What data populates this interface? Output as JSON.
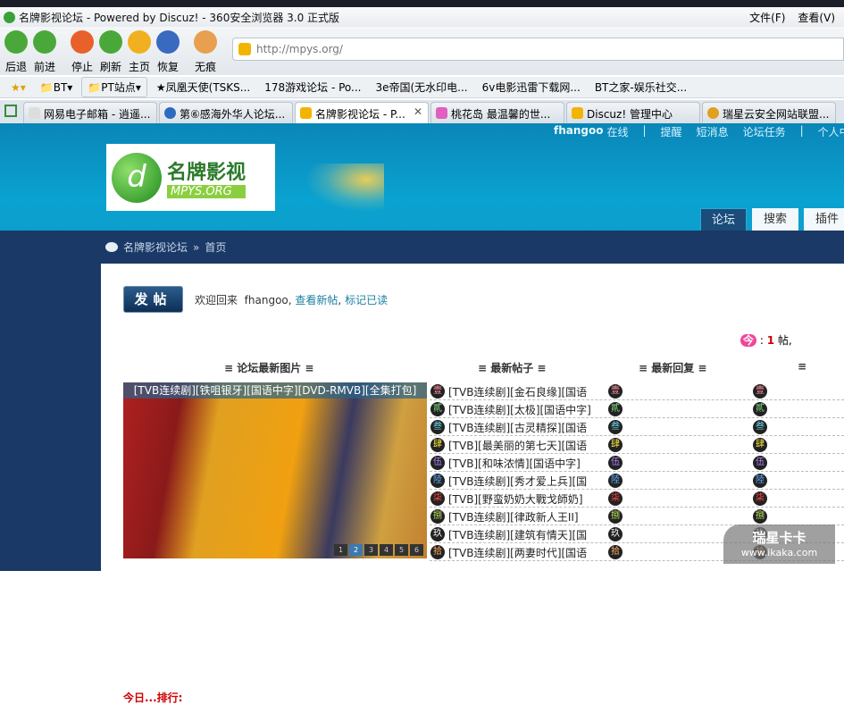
{
  "window": {
    "title": "名牌影视论坛 - Powered by Discuz! - 360安全浏览器 3.0 正式版",
    "menus": [
      "文件(F)",
      "查看(V)"
    ]
  },
  "toolbar": {
    "buttons": [
      {
        "label": "后退",
        "icon": "back-arrow-icon",
        "color": "#4aa83a"
      },
      {
        "label": "前进",
        "icon": "forward-arrow-icon",
        "color": "#4aa83a"
      },
      {
        "label": "停止",
        "icon": "stop-icon",
        "color": "#e8602a"
      },
      {
        "label": "刷新",
        "icon": "refresh-icon",
        "color": "#4aa83a"
      },
      {
        "label": "主页",
        "icon": "home-icon",
        "color": "#f0b020"
      },
      {
        "label": "恢复",
        "icon": "undo-icon",
        "color": "#3a6ac0"
      },
      {
        "label": "无痕",
        "icon": "paw-icon",
        "color": "#e8a050"
      }
    ],
    "address": "http://mpys.org/"
  },
  "bookmarks": [
    "BT",
    "PT站点",
    "★凤凰天使(TSKS...",
    "178游戏论坛 - Po...",
    "3e帝国(无水印电...",
    "6v电影迅雷下载网...",
    "BT之家-娱乐社交..."
  ],
  "tabs": [
    {
      "label": "网易电子邮箱 - 逍遥..."
    },
    {
      "label": "第⑥感海外华人论坛..."
    },
    {
      "label": "名牌影视论坛 - P...",
      "active": true
    },
    {
      "label": "桃花岛 最温馨的世..."
    },
    {
      "label": "Discuz! 管理中心"
    },
    {
      "label": "瑞星云安全网站联盟..."
    }
  ],
  "site": {
    "toplinks": {
      "user": "fhangoo",
      "online": "在线",
      "sep": "|",
      "items": [
        "提醒",
        "短消息",
        "论坛任务"
      ],
      "sep2": "|",
      "profile": "个人中"
    },
    "logo": {
      "name": "名牌影视",
      "domain": "MPYS.ORG"
    },
    "nav": [
      "论坛",
      "搜索",
      "插件"
    ],
    "breadcrumb": {
      "home": "名牌影视论坛",
      "sep": "»",
      "current": "首页"
    },
    "post_button": "发帖",
    "welcome": {
      "prefix": "欢迎回来",
      "user": "fhangoo,",
      "new_posts": "查看新帖",
      "sep": ",",
      "mark_read": "标记已读"
    },
    "stats": {
      "today_icon": "今",
      "sep": ":",
      "count": "1",
      "unit": "帖,"
    },
    "columns": [
      "≡ 论坛最新图片 ≡",
      "≡ 最新帖子 ≡",
      "≡ 最新回复 ≡",
      "≡"
    ],
    "slideshow": {
      "caption": "[TVB连续剧][铁咀银牙][国语中字][DVD-RMVB][全集打包]",
      "pages": [
        "1",
        "2",
        "3",
        "4",
        "5",
        "6"
      ],
      "current": 2
    },
    "badges": [
      {
        "t": "壹",
        "c": "#ff8aa0"
      },
      {
        "t": "貳",
        "c": "#7ee07e"
      },
      {
        "t": "叁",
        "c": "#6ad8e8"
      },
      {
        "t": "肆",
        "c": "#f0e040"
      },
      {
        "t": "伍",
        "c": "#b080ff"
      },
      {
        "t": "陸",
        "c": "#60b0ff"
      },
      {
        "t": "柒",
        "c": "#ff4040"
      },
      {
        "t": "捌",
        "c": "#c0f060"
      },
      {
        "t": "玖",
        "c": "#ffffff"
      },
      {
        "t": "拾",
        "c": "#ffb060"
      }
    ],
    "latest_posts": [
      "[TVB连续剧][金石良缘][国语",
      "[TVB连续剧][太极][国语中字]",
      "[TVB连续剧][古灵精探][国语",
      "[TVB][最美丽的第七天][国语",
      "[TVB][和味浓情][国语中字]",
      "[TVB连续剧][秀才爱上兵][国",
      "[TVB][野蛮奶奶大戰戈師奶]",
      "[TVB连续剧][律政新人王II]",
      "[TVB连续剧][建筑有情天][国",
      "[TVB连续剧][两妻时代][国语"
    ],
    "bottom_heading": "今日...排行:"
  },
  "watermark": {
    "title": "瑞星卡卡",
    "url": "www.ikaka.com"
  }
}
